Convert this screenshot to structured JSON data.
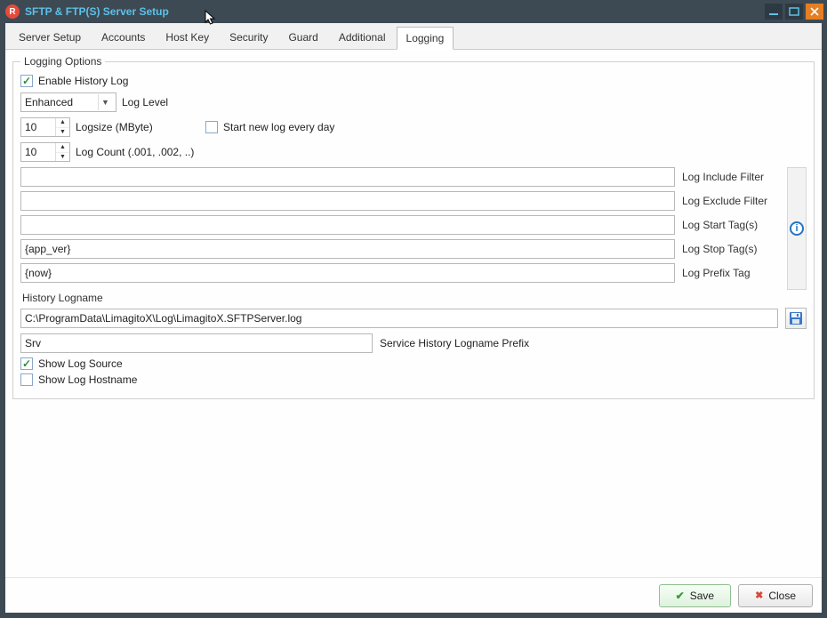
{
  "window": {
    "title": "SFTP & FTP(S) Server Setup",
    "app_badge": "R"
  },
  "tabs": {
    "items": [
      {
        "label": "Server Setup"
      },
      {
        "label": "Accounts"
      },
      {
        "label": "Host Key"
      },
      {
        "label": "Security"
      },
      {
        "label": "Guard"
      },
      {
        "label": "Additional"
      },
      {
        "label": "Logging"
      }
    ],
    "active_index": 6
  },
  "group": {
    "legend": "Logging Options"
  },
  "fields": {
    "enable_history_log": {
      "label": "Enable History Log",
      "checked": true
    },
    "log_level": {
      "value": "Enhanced",
      "label": "Log Level"
    },
    "logsize": {
      "value": "10",
      "label": "Logsize (MByte)"
    },
    "start_new_log": {
      "label": "Start new log every day",
      "checked": false
    },
    "log_count": {
      "value": "10",
      "label": "Log Count (.001, .002, ..)"
    },
    "include_filter": {
      "value": "",
      "label": "Log Include Filter"
    },
    "exclude_filter": {
      "value": "",
      "label": "Log Exclude Filter"
    },
    "start_tags": {
      "value": "",
      "label": "Log Start Tag(s)"
    },
    "stop_tags": {
      "value": "{app_ver}",
      "label": "Log Stop Tag(s)"
    },
    "prefix_tag": {
      "value": "{now}",
      "label": "Log Prefix Tag"
    },
    "history_logname_label": "History Logname",
    "history_logname": {
      "value": "C:\\ProgramData\\LimagitoX\\Log\\LimagitoX.SFTPServer.log"
    },
    "service_prefix": {
      "value": "Srv",
      "label": "Service History Logname Prefix"
    },
    "show_log_source": {
      "label": "Show Log Source",
      "checked": true
    },
    "show_log_hostname": {
      "label": "Show Log Hostname",
      "checked": false
    }
  },
  "buttons": {
    "save": "Save",
    "close": "Close"
  }
}
